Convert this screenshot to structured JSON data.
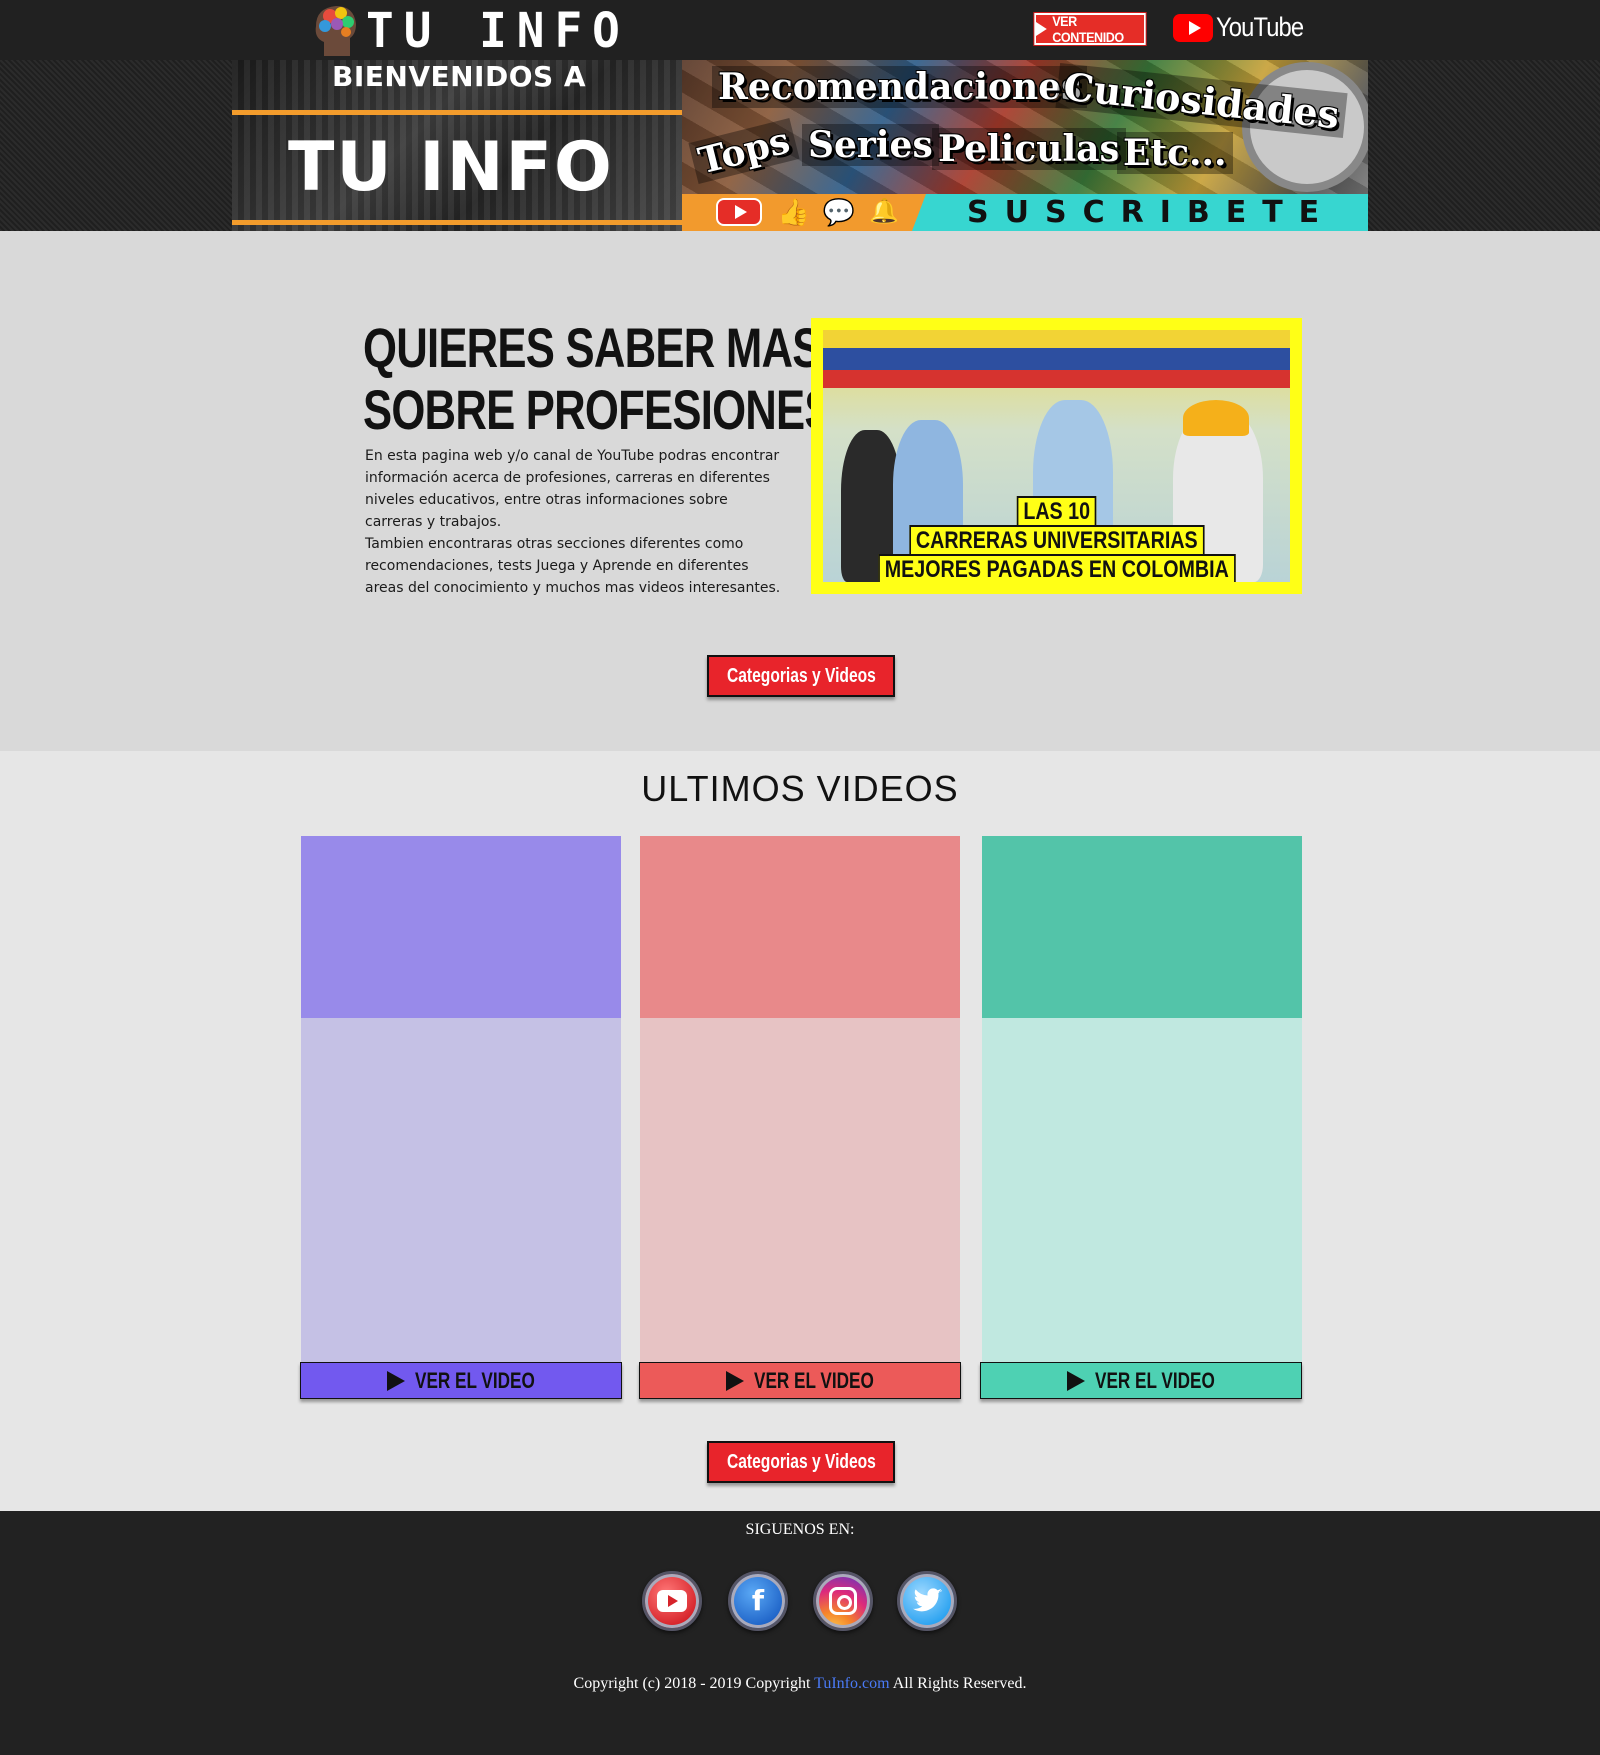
{
  "header": {
    "logo_text": "TU INFO",
    "ver_contenido_label": "VER CONTENIDO",
    "youtube_label": "YouTube"
  },
  "banner": {
    "welcome": "BIENVENIDOS A",
    "brand": "TU INFO",
    "keywords": [
      "Recomendaciones",
      "Curiosidades",
      "Tops",
      "Series",
      "Peliculas",
      "Etc..."
    ],
    "subscribe": "SUSCRIBETE"
  },
  "hero": {
    "title_line1": "QUIERES SABER MAS",
    "title_line2": "SOBRE PROFESIONES",
    "paragraph1": "En esta pagina web y/o canal de YouTube podras encontrar información acerca de profesiones, carreras en diferentes niveles educativos, entre otras informaciones sobre carreras y trabajos.",
    "paragraph2": "Tambien encontraras otras secciones diferentes como recomendaciones, tests Juega y Aprende en diferentes areas del conocimiento y muchos mas videos interesantes.",
    "image_caption_1": "LAS 10",
    "image_caption_2": "CARRERAS UNIVERSITARIAS",
    "image_caption_3": "MEJORES PAGADAS EN COLOMBIA",
    "cta_label": "Categorias y Videos"
  },
  "latest": {
    "title": "ULTIMOS VIDEOS",
    "cards": [
      {
        "button_label": "VER EL VIDEO",
        "color": "#7259ef"
      },
      {
        "button_label": "VER EL VIDEO",
        "color": "#ec5a59"
      },
      {
        "button_label": "VER EL VIDEO",
        "color": "#4ed1b3"
      }
    ],
    "cta_label": "Categorias y Videos"
  },
  "footer": {
    "follow_label": "SIGUENOS EN:",
    "social": [
      "youtube-icon",
      "facebook-icon",
      "instagram-icon",
      "twitter-icon"
    ],
    "copyright_prefix": "Copyright (c) 2018 - 2019 Copyright",
    "copyright_link": "TuInfo.com",
    "copyright_suffix": "All Rights Reserved."
  }
}
